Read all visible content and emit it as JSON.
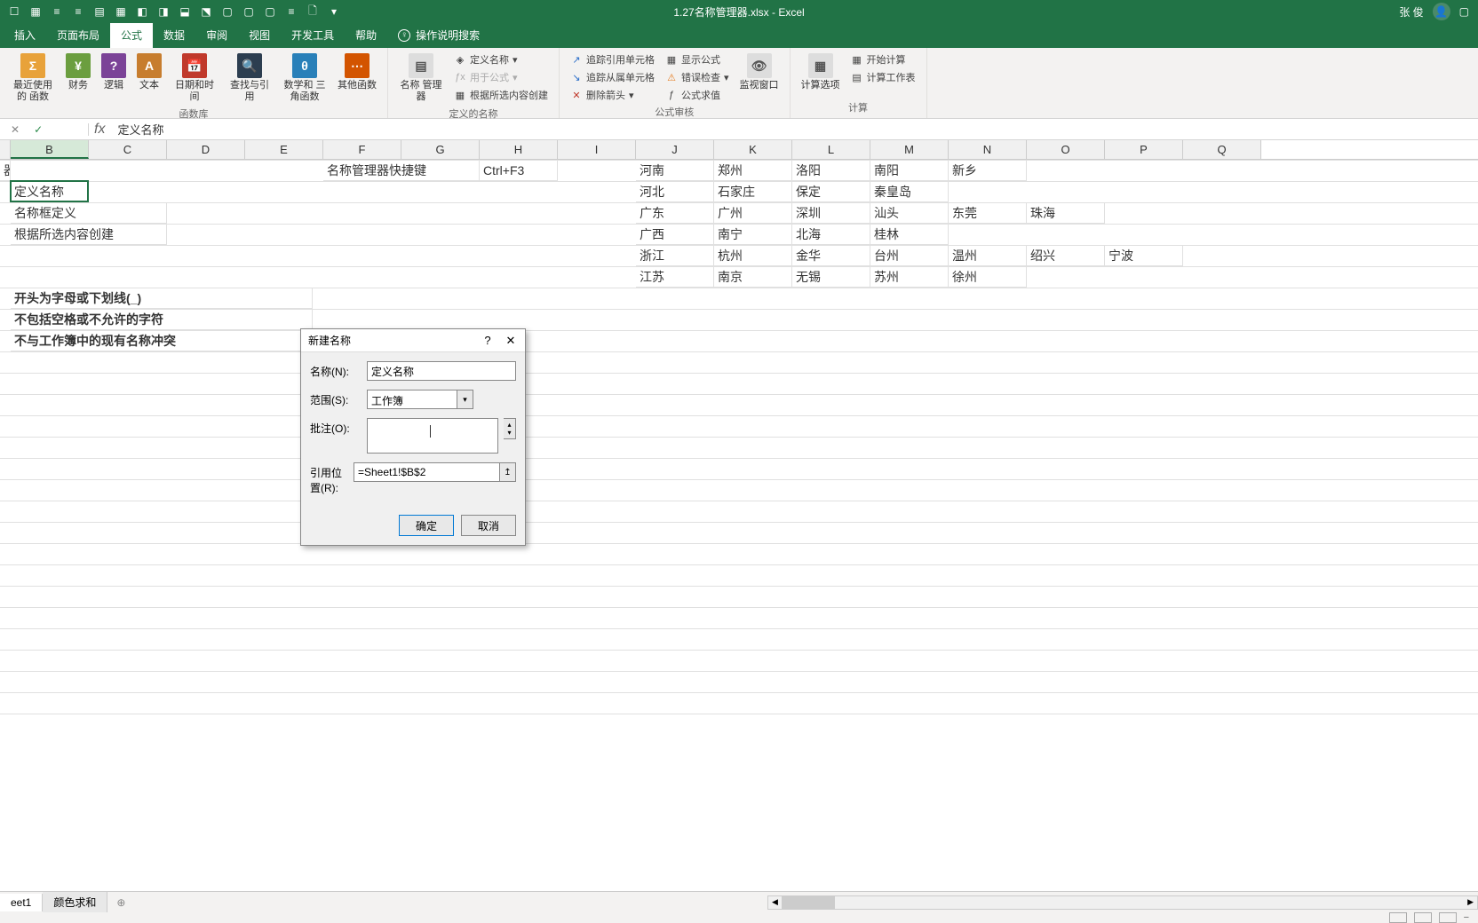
{
  "title": {
    "filename": "1.27名称管理器.xlsx",
    "app": "Excel",
    "user": "张 俊"
  },
  "tabs": {
    "insert": "插入",
    "layout": "页面布局",
    "formula": "公式",
    "data": "数据",
    "review": "审阅",
    "view": "视图",
    "dev": "开发工具",
    "help": "帮助",
    "search": "操作说明搜索"
  },
  "ribbon": {
    "group1": {
      "recent": "最近使用的\n函数",
      "finance": "财务",
      "logic": "逻辑",
      "text": "文本",
      "datetime": "日期和时间",
      "lookup": "查找与引用",
      "math": "数学和\n三角函数",
      "other": "其他函数",
      "label": "函数库"
    },
    "group2": {
      "manager": "名称\n管理器",
      "define": "定义名称",
      "useInFormula": "用于公式",
      "createFromSel": "根据所选内容创建",
      "label": "定义的名称"
    },
    "group3": {
      "tracePrec": "追踪引用单元格",
      "traceDep": "追踪从属单元格",
      "removeArrow": "删除箭头",
      "showFormula": "显示公式",
      "errorCheck": "错误检查",
      "evalFormula": "公式求值",
      "watch": "监视窗口",
      "label": "公式审核"
    },
    "group4": {
      "calcOpt": "计算选项",
      "calcNow": "开始计算",
      "calcSheet": "计算工作表",
      "label": "计算"
    }
  },
  "formulaBar": {
    "value": "定义名称"
  },
  "columns": [
    "B",
    "C",
    "D",
    "E",
    "F",
    "G",
    "H",
    "I",
    "J",
    "K",
    "L",
    "M",
    "N",
    "O",
    "P",
    "Q"
  ],
  "cellData": {
    "r1": {
      "A": "器",
      "F": "名称管理器快捷键",
      "H": "Ctrl+F3",
      "J": "河南",
      "K": "郑州",
      "L": "洛阳",
      "M": "南阳",
      "N": "新乡"
    },
    "r2": {
      "B": "定义名称",
      "J": "河北",
      "K": "石家庄",
      "L": "保定",
      "M": "秦皇岛"
    },
    "r3": {
      "B": "名称框定义",
      "J": "广东",
      "K": "广州",
      "L": "深圳",
      "M": "汕头",
      "N": "东莞",
      "O": "珠海"
    },
    "r4": {
      "B": "根据所选内容创建",
      "J": "广西",
      "K": "南宁",
      "L": "北海",
      "M": "桂林"
    },
    "r5": {
      "J": "浙江",
      "K": "杭州",
      "L": "金华",
      "M": "台州",
      "N": "温州",
      "O": "绍兴",
      "P": "宁波"
    },
    "r6": {
      "J": "江苏",
      "K": "南京",
      "L": "无锡",
      "M": "苏州",
      "N": "徐州"
    },
    "r8": {
      "B": "开头为字母或下划线(_)"
    },
    "r9": {
      "B": "不包括空格或不允许的字符"
    },
    "r10": {
      "B": "不与工作簿中的现有名称冲突"
    }
  },
  "dialog": {
    "title": "新建名称",
    "nameLabel": "名称(N):",
    "nameValue": "定义名称",
    "scopeLabel": "范围(S):",
    "scopeValue": "工作簿",
    "commentLabel": "批注(O):",
    "refLabel": "引用位置(R):",
    "refValue": "=Sheet1!$B$2",
    "ok": "确定",
    "cancel": "取消"
  },
  "sheets": {
    "s1": "eet1",
    "s2": "颜色求和"
  }
}
